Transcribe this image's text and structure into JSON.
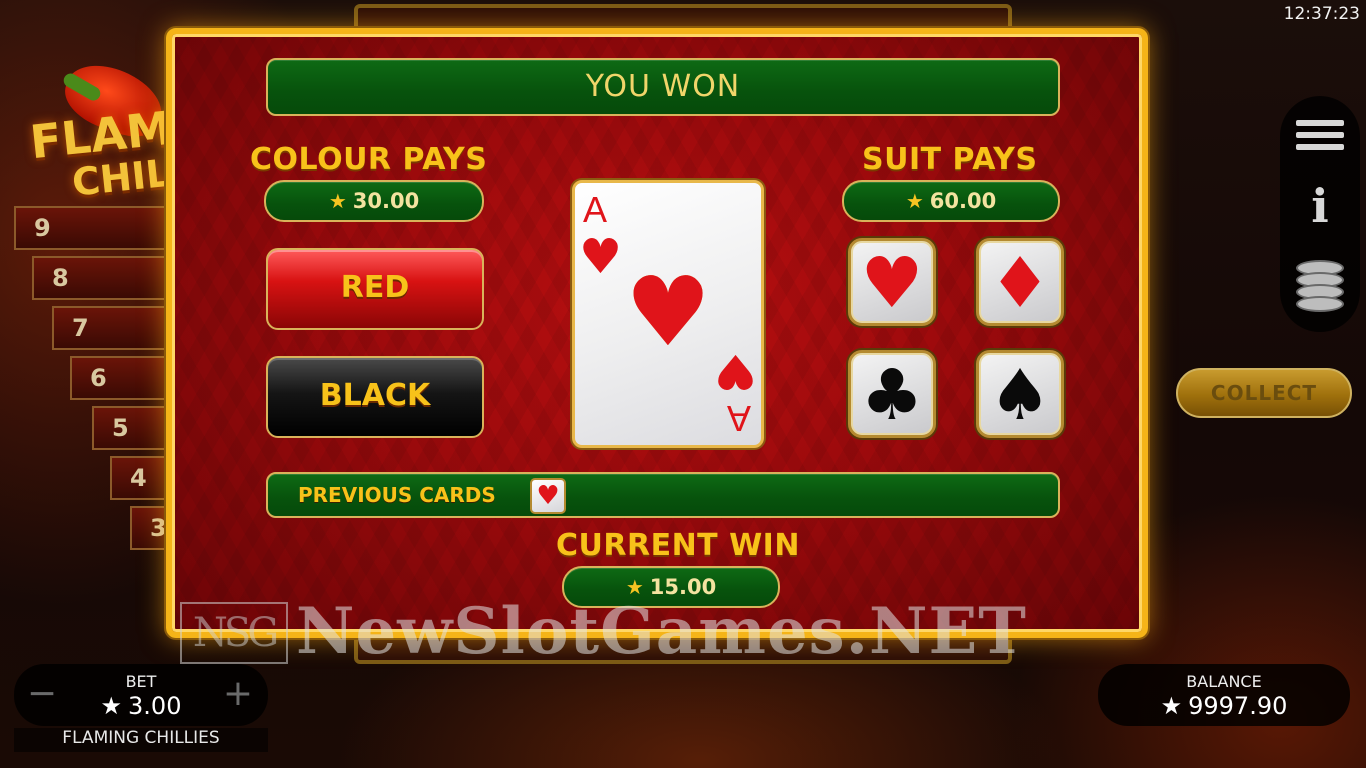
{
  "clock": "12:37:23",
  "logo": {
    "line1": "FLAM",
    "line2": "CHILI"
  },
  "paylines": [
    "9",
    "8",
    "7",
    "6",
    "5",
    "4",
    "3"
  ],
  "gamble": {
    "banner": "YOU WON",
    "colour_pays": {
      "heading": "COLOUR PAYS",
      "value": "30.00"
    },
    "suit_pays": {
      "heading": "SUIT PAYS",
      "value": "60.00"
    },
    "red_button": "RED",
    "black_button": "BLACK",
    "card": {
      "rank": "A",
      "suit": "heart",
      "suit_glyph": "♥",
      "color": "#e0141a"
    },
    "suits": [
      {
        "name": "hearts",
        "glyph": "♥",
        "color": "red"
      },
      {
        "name": "diamonds",
        "glyph": "♦",
        "color": "red"
      },
      {
        "name": "clubs",
        "glyph": "♣",
        "color": "black"
      },
      {
        "name": "spades",
        "glyph": "♠",
        "color": "black"
      }
    ],
    "previous_cards": {
      "label": "PREVIOUS CARDS",
      "cards": [
        "♥"
      ]
    },
    "current_win": {
      "heading": "CURRENT WIN",
      "value": "15.00"
    }
  },
  "collect_button": "COLLECT",
  "bet": {
    "label": "BET",
    "value": "3.00",
    "minus": "−",
    "plus": "+"
  },
  "game_name": "FLAMING CHILLIES",
  "balance": {
    "label": "BALANCE",
    "value": "9997.90"
  },
  "watermark": {
    "badge": "NSG",
    "text": "NewSlotGames.NET"
  },
  "colors": {
    "frame_gold": "#f5b418",
    "panel_red": "#b80f10",
    "bar_green": "#0e6a14",
    "heading_gold": "#f8c21a"
  }
}
